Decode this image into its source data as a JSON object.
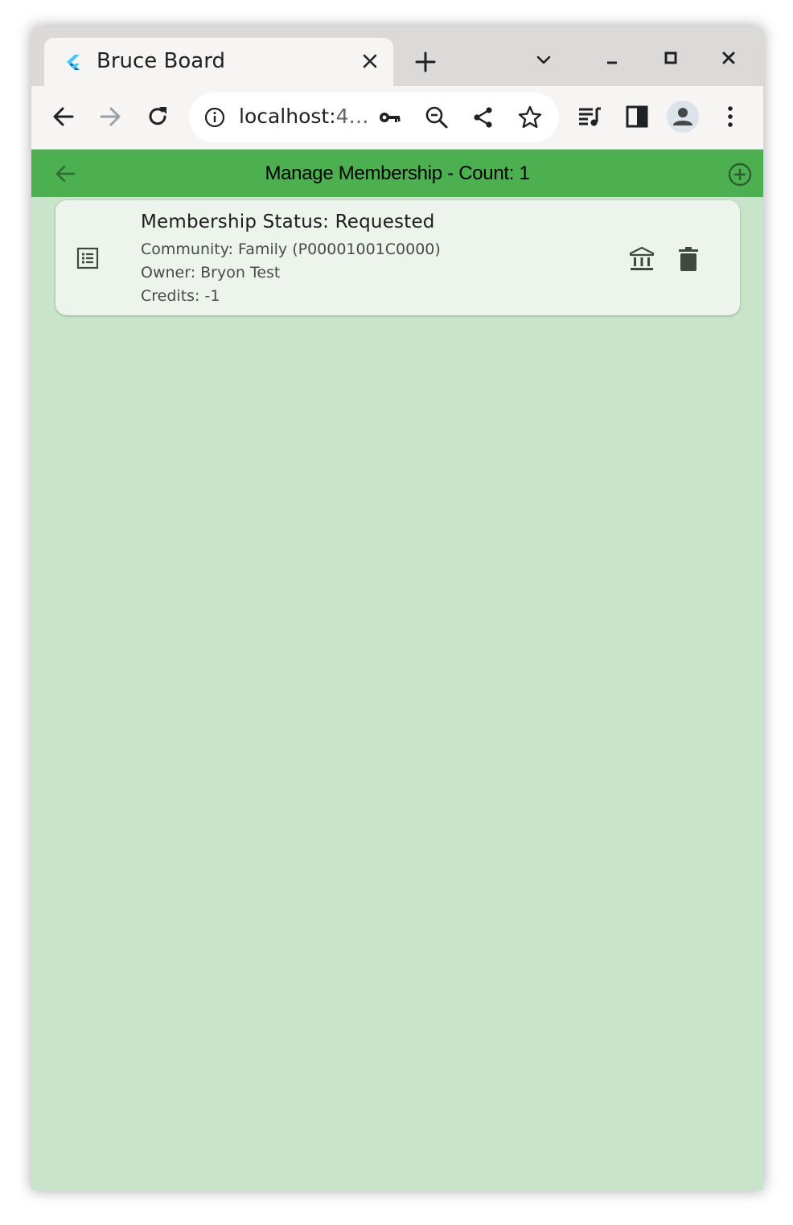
{
  "browser": {
    "tab_title": "Bruce Board",
    "url_host": "localhost:",
    "url_rest": "4…",
    "colors": {
      "tabstrip": "#dcdad8",
      "toolbar": "#f6f5f4"
    }
  },
  "appbar": {
    "title": "Manage Membership - Count: 1",
    "back_icon": "arrow-back-icon",
    "add_icon": "add-circle-icon",
    "color": "#4caf50"
  },
  "membership_list": [
    {
      "status": "Membership Status: Requested",
      "community": "Community: Family (P00001001C0000)",
      "owner": "Owner: Bryon Test",
      "credits": "Credits: -1",
      "leading_icon": "list-alt-icon",
      "actions": [
        "account-balance-icon",
        "delete-icon"
      ]
    }
  ],
  "page": {
    "background": "#c8e5c9",
    "card_background": "#edf4ec"
  }
}
